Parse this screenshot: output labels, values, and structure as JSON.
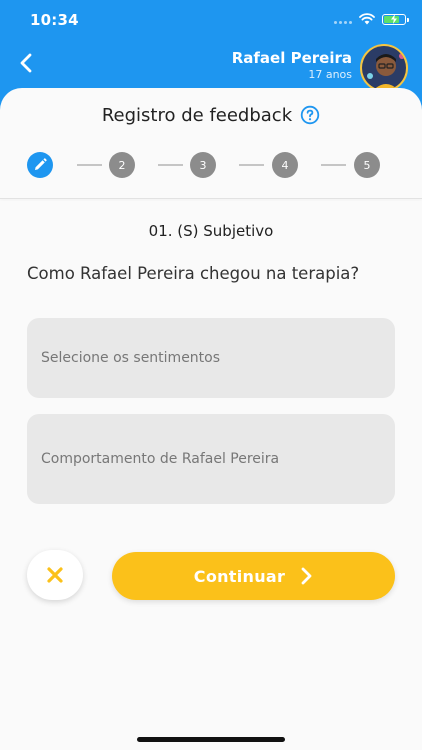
{
  "status_bar": {
    "time": "10:34",
    "icons": [
      "signal-icon",
      "wifi-icon",
      "battery-charging-icon"
    ]
  },
  "header": {
    "back_icon": "chevron-left-icon",
    "user_name": "Rafael Pereira",
    "user_age": "17 anos"
  },
  "card": {
    "title": "Registro de feedback",
    "help_icon": "help-circle-icon"
  },
  "stepper": {
    "active_icon": "pencil-icon",
    "steps": [
      "2",
      "3",
      "4",
      "5"
    ]
  },
  "form": {
    "section_title": "01. (S) Subjetivo",
    "question": "Como Rafael Pereira chegou na terapia?",
    "feelings_placeholder": "Selecione os sentimentos",
    "behavior_placeholder": "Comportamento de Rafael Pereira"
  },
  "actions": {
    "cancel_icon": "close-icon",
    "continue_label": "Continuar",
    "continue_icon": "chevron-right-icon"
  },
  "colors": {
    "primary": "#1e96f0",
    "accent": "#fbc11a",
    "field_bg": "#e8e8e8"
  }
}
